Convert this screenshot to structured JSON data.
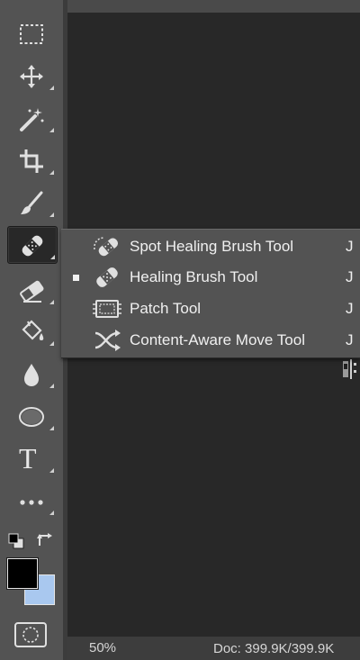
{
  "toolbar": {
    "tools": [
      {
        "name": "marquee-tool",
        "icon": "rect-marquee-icon"
      },
      {
        "name": "move-tool",
        "icon": "move-icon"
      },
      {
        "name": "magic-wand-tool",
        "icon": "magic-wand-icon"
      },
      {
        "name": "crop-tool",
        "icon": "crop-icon"
      },
      {
        "name": "brush-tool",
        "icon": "brush-icon"
      },
      {
        "name": "healing-brush-tool",
        "icon": "bandage-icon",
        "active": true
      },
      {
        "name": "eraser-tool",
        "icon": "eraser-icon"
      },
      {
        "name": "paint-bucket-tool",
        "icon": "paint-bucket-icon"
      },
      {
        "name": "blur-tool",
        "icon": "drop-icon"
      },
      {
        "name": "ellipse-tool",
        "icon": "ellipse-icon"
      },
      {
        "name": "type-tool",
        "icon": "type-icon"
      },
      {
        "name": "more-tools",
        "icon": "ellipsis-icon"
      }
    ],
    "type_glyph": "T",
    "foreground_color": "#000000",
    "background_color": "#a9c8ef"
  },
  "flyout": {
    "items": [
      {
        "label": "Spot Healing Brush Tool",
        "shortcut": "J",
        "icon": "spot-healing-icon",
        "selected": false
      },
      {
        "label": "Healing Brush Tool",
        "shortcut": "J",
        "icon": "bandage-icon",
        "selected": true
      },
      {
        "label": "Patch Tool",
        "shortcut": "J",
        "icon": "patch-icon",
        "selected": false
      },
      {
        "label": "Content-Aware Move Tool",
        "shortcut": "J",
        "icon": "content-aware-move-icon",
        "selected": false
      }
    ]
  },
  "status": {
    "zoom": "50%",
    "doc": "Doc: 399.9K/399.9K"
  },
  "colors": {
    "panel": "#535353",
    "canvas": "#282828",
    "text": "#f0f0f0"
  }
}
